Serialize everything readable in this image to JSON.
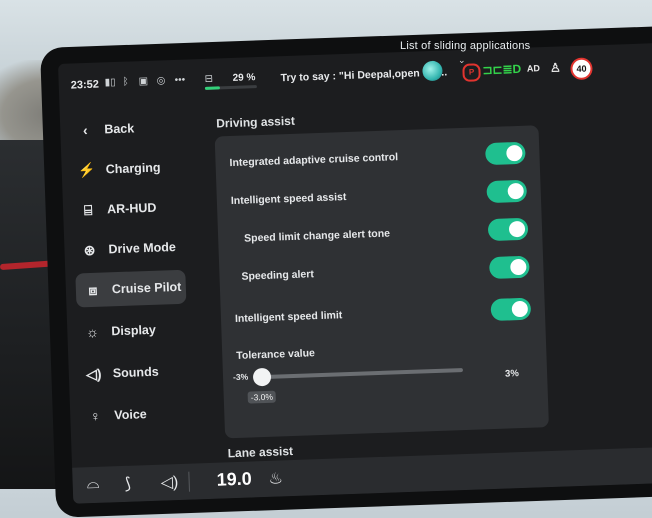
{
  "overlay": {
    "tooltip_label": "List of sliding applications"
  },
  "status_bar": {
    "time": "23:52",
    "battery_percent": "29",
    "battery_unit": "%",
    "battery_level": 0.29,
    "voice_hint": "Try to say : \"Hi Deepal,open the...",
    "speed_limit_sign": "40",
    "icons": [
      "signal-icon",
      "bluetooth-icon",
      "video-record-icon",
      "webcam-icon",
      "more-dots-icon",
      "car-battery-icon"
    ],
    "telltales": [
      "parking-brake-icon",
      "position-lights-icon",
      "low-beam-icon",
      "auto-headlight-icon",
      "seatbelt-icon",
      "speed-limit-sign-icon"
    ]
  },
  "sidebar": {
    "items": [
      {
        "label": "Back",
        "icon": "chevron-left-icon"
      },
      {
        "label": "Charging",
        "icon": "charging-icon"
      },
      {
        "label": "AR-HUD",
        "icon": "hud-icon"
      },
      {
        "label": "Drive Mode",
        "icon": "steering-wheel-icon"
      },
      {
        "label": "Cruise Pilot",
        "icon": "cruise-pilot-icon",
        "active": true
      },
      {
        "label": "Display",
        "icon": "brightness-icon"
      },
      {
        "label": "Sounds",
        "icon": "speaker-icon"
      },
      {
        "label": "Voice",
        "icon": "voice-icon"
      }
    ]
  },
  "driving_assist": {
    "title": "Driving assist",
    "options": [
      {
        "label": "Integrated adaptive cruise control",
        "enabled": true
      },
      {
        "label": "Intelligent speed assist",
        "enabled": true
      },
      {
        "label": "Speed limit change alert tone",
        "enabled": true
      },
      {
        "label": "Speeding alert",
        "enabled": true
      },
      {
        "label": "Intelligent speed limit",
        "enabled": true
      }
    ],
    "tolerance": {
      "label": "Tolerance value",
      "min_label": "-3%",
      "max_label": "3%",
      "current_label": "-3.0%",
      "current_value": -3.0
    }
  },
  "lane_assist": {
    "title": "Lane assist"
  },
  "dock": {
    "temperature": "19.0",
    "icons": [
      "windshield-defrost-icon",
      "wiper-icon",
      "volume-icon",
      "seat-heat-icon"
    ]
  },
  "colors": {
    "toggle_on": "#1fbf8f",
    "panel_bg": "#2f3134",
    "screen_bg": "#1c1d1f",
    "accent_red": "#e2342f",
    "accent_green": "#33d24a"
  }
}
